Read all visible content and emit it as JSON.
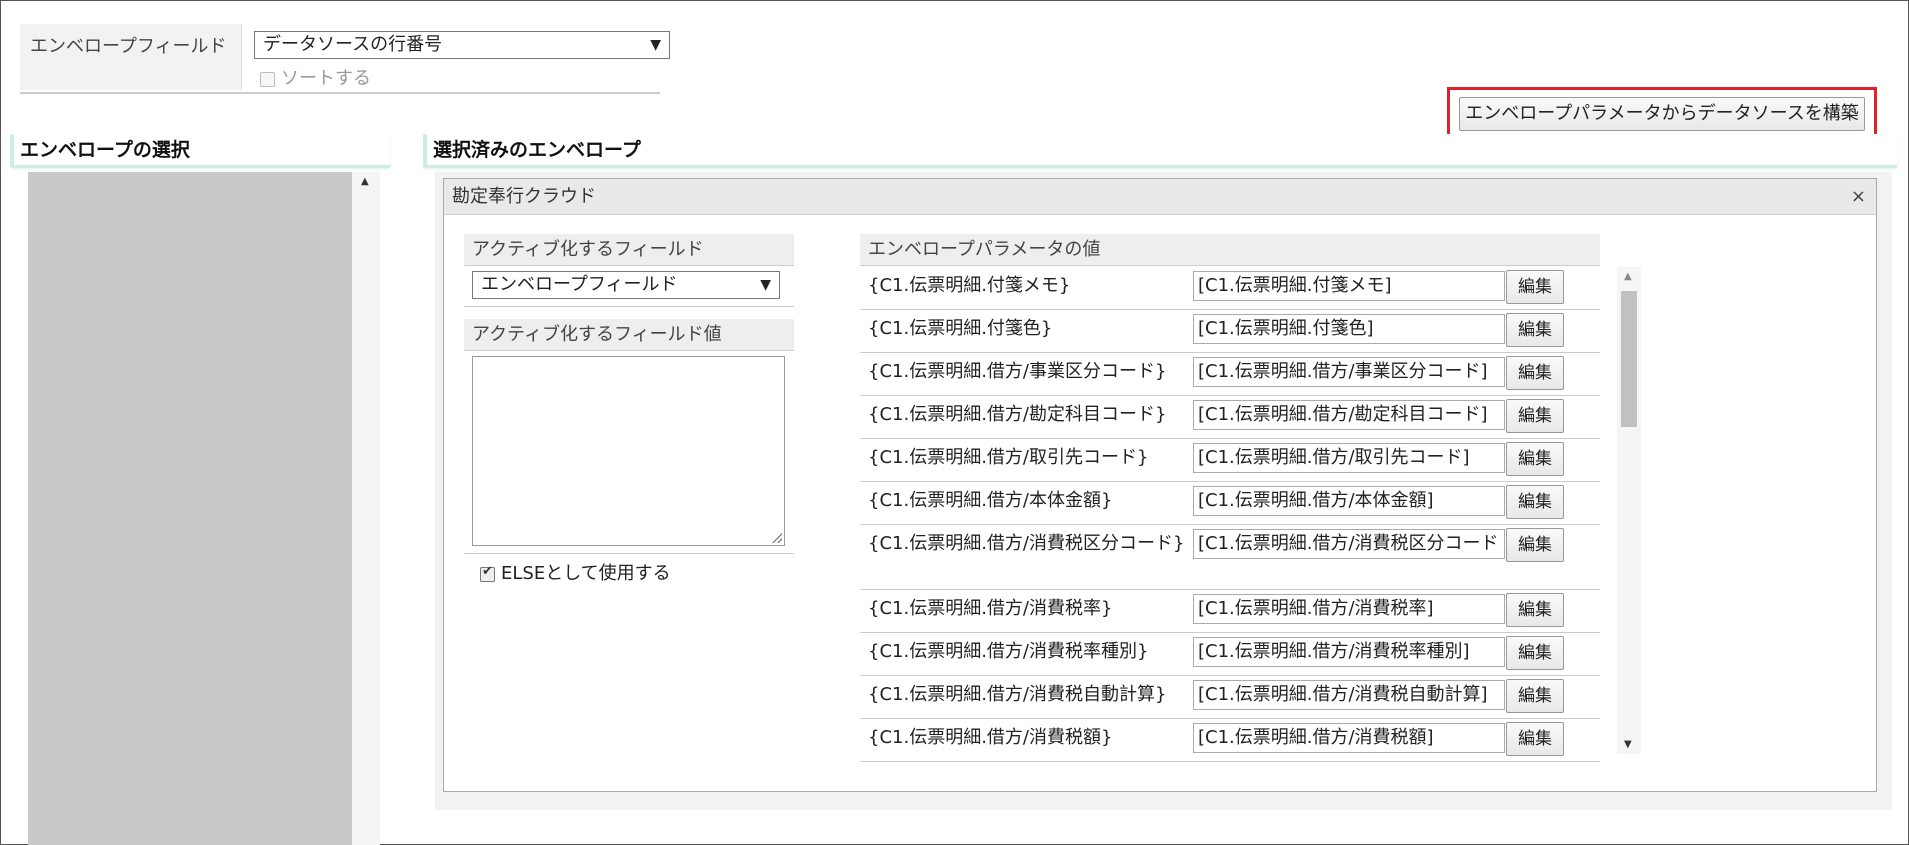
{
  "envelope_field": {
    "label": "エンベロープフィールド",
    "selected": "データソースの行番号",
    "sort_label": "ソートする",
    "sort_checked": false
  },
  "build_button": "エンベロープパラメータからデータソースを構築",
  "left_section": {
    "title": "エンベロープの選択"
  },
  "right_section": {
    "title": "選択済みのエンベロープ",
    "panel": {
      "title": "勘定奉行クラウド",
      "close": "×",
      "active_field": {
        "header": "アクティブ化するフィールド",
        "selected": "エンベロープフィールド"
      },
      "active_value": {
        "header": "アクティブ化するフィールド値"
      },
      "else": {
        "label": "ELSEとして使用する",
        "checked": true
      },
      "params": {
        "header": "エンベロープパラメータの値",
        "edit_label": "編集",
        "rows": [
          {
            "name": "{C1.伝票明細.付箋メモ}",
            "value": "[C1.伝票明細.付箋メモ]"
          },
          {
            "name": "{C1.伝票明細.付箋色}",
            "value": "[C1.伝票明細.付箋色]"
          },
          {
            "name": "{C1.伝票明細.借方/事業区分コード}",
            "value": "[C1.伝票明細.借方/事業区分コード]"
          },
          {
            "name": "{C1.伝票明細.借方/勘定科目コード}",
            "value": "[C1.伝票明細.借方/勘定科目コード]"
          },
          {
            "name": "{C1.伝票明細.借方/取引先コード}",
            "value": "[C1.伝票明細.借方/取引先コード]"
          },
          {
            "name": "{C1.伝票明細.借方/本体金額}",
            "value": "[C1.伝票明細.借方/本体金額]"
          },
          {
            "name": "{C1.伝票明細.借方/消費税区分コード}",
            "value": "[C1.伝票明細.借方/消費税区分コード"
          },
          {
            "name": "{C1.伝票明細.借方/消費税率}",
            "value": "[C1.伝票明細.借方/消費税率]"
          },
          {
            "name": "{C1.伝票明細.借方/消費税率種別}",
            "value": "[C1.伝票明細.借方/消費税率種別]"
          },
          {
            "name": "{C1.伝票明細.借方/消費税自動計算}",
            "value": "[C1.伝票明細.借方/消費税自動計算]"
          },
          {
            "name": "{C1.伝票明細.借方/消費税額}",
            "value": "[C1.伝票明細.借方/消費税額]"
          }
        ]
      }
    }
  },
  "icons": {
    "dropdown": "▼",
    "scroll_up": "▲",
    "scroll_down": "▼"
  },
  "colors": {
    "highlight": "#e0202a",
    "section_accent": "#cdeee2",
    "list_bg": "#c9c9c9"
  }
}
